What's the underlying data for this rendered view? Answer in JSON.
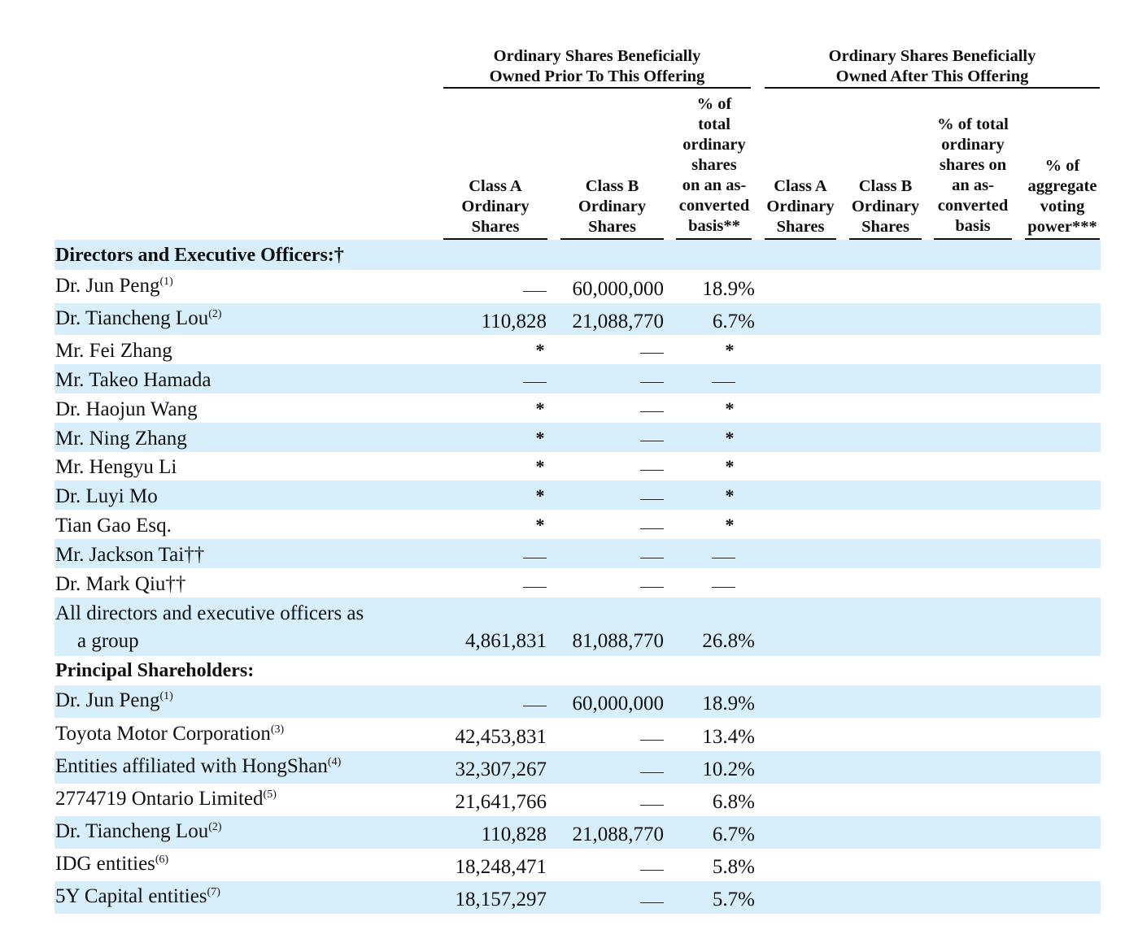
{
  "header": {
    "group_before": [
      "Ordinary Shares Beneficially",
      "Owned Prior To This Offering"
    ],
    "group_after": [
      "Ordinary Shares Beneficially",
      "Owned After This Offering"
    ],
    "columns": [
      [
        "Class A",
        "Ordinary",
        "Shares"
      ],
      [
        "Class B",
        "Ordinary",
        "Shares"
      ],
      [
        "% of",
        "total",
        "ordinary",
        "shares",
        "on an as-",
        "converted",
        "basis**"
      ],
      [
        "Class A",
        "Ordinary",
        "Shares"
      ],
      [
        "Class B",
        "Ordinary",
        "Shares"
      ],
      [
        "% of total",
        "ordinary",
        "shares on",
        "an as-",
        "converted",
        "basis"
      ],
      [
        "% of",
        "aggregate",
        "voting",
        "power***"
      ]
    ]
  },
  "sections": {
    "directors": "Directors and Executive Officers:†",
    "principal": "Principal Shareholders:"
  },
  "rows": [
    {
      "name": "Dr. Jun Peng",
      "note": "(1)",
      "class_a": "—",
      "class_b": "60,000,000",
      "pct": "18.9%"
    },
    {
      "name": "Dr. Tiancheng Lou",
      "note": "(2)",
      "class_a": "110,828",
      "class_b": "21,088,770",
      "pct": "6.7%"
    },
    {
      "name": "Mr. Fei Zhang",
      "note": "",
      "class_a": "*",
      "class_b": "—",
      "pct": "*"
    },
    {
      "name": "Mr. Takeo Hamada",
      "note": "",
      "class_a": "—",
      "class_b": "—",
      "pct": "—"
    },
    {
      "name": "Dr. Haojun Wang",
      "note": "",
      "class_a": "*",
      "class_b": "—",
      "pct": "*"
    },
    {
      "name": "Mr. Ning Zhang",
      "note": "",
      "class_a": "*",
      "class_b": "—",
      "pct": "*"
    },
    {
      "name": "Mr. Hengyu Li",
      "note": "",
      "class_a": "*",
      "class_b": "—",
      "pct": "*"
    },
    {
      "name": "Dr. Luyi Mo",
      "note": "",
      "class_a": "*",
      "class_b": "—",
      "pct": "*"
    },
    {
      "name": "Tian Gao Esq.",
      "note": "",
      "class_a": "*",
      "class_b": "—",
      "pct": "*"
    },
    {
      "name": "Mr. Jackson Tai††",
      "note": "",
      "class_a": "—",
      "class_b": "—",
      "pct": "—"
    },
    {
      "name": "Dr. Mark Qiu††",
      "note": "",
      "class_a": "—",
      "class_b": "—",
      "pct": "—"
    },
    {
      "name": "All directors and executive officers as",
      "name2": "a group",
      "note": "",
      "class_a": "4,861,831",
      "class_b": "81,088,770",
      "pct": "26.8%"
    },
    {
      "name": "Dr. Jun Peng",
      "note": "(1)",
      "class_a": "—",
      "class_b": "60,000,000",
      "pct": "18.9%"
    },
    {
      "name": "Toyota Motor Corporation",
      "note": "(3)",
      "class_a": "42,453,831",
      "class_b": "—",
      "pct": "13.4%"
    },
    {
      "name": "Entities affiliated with HongShan",
      "note": "(4)",
      "class_a": "32,307,267",
      "class_b": "—",
      "pct": "10.2%"
    },
    {
      "name": "2774719 Ontario Limited",
      "note": "(5)",
      "class_a": "21,641,766",
      "class_b": "—",
      "pct": "6.8%"
    },
    {
      "name": "Dr. Tiancheng Lou",
      "note": "(2)",
      "class_a": "110,828",
      "class_b": "21,088,770",
      "pct": "6.7%"
    },
    {
      "name": "IDG entities",
      "note": "(6)",
      "class_a": "18,248,471",
      "class_b": "—",
      "pct": "5.8%"
    },
    {
      "name": "5Y Capital entities",
      "note": "(7)",
      "class_a": "18,157,297",
      "class_b": "—",
      "pct": "5.7%"
    }
  ],
  "colors": {
    "stripe": "#d6effb",
    "text": "#111111"
  }
}
